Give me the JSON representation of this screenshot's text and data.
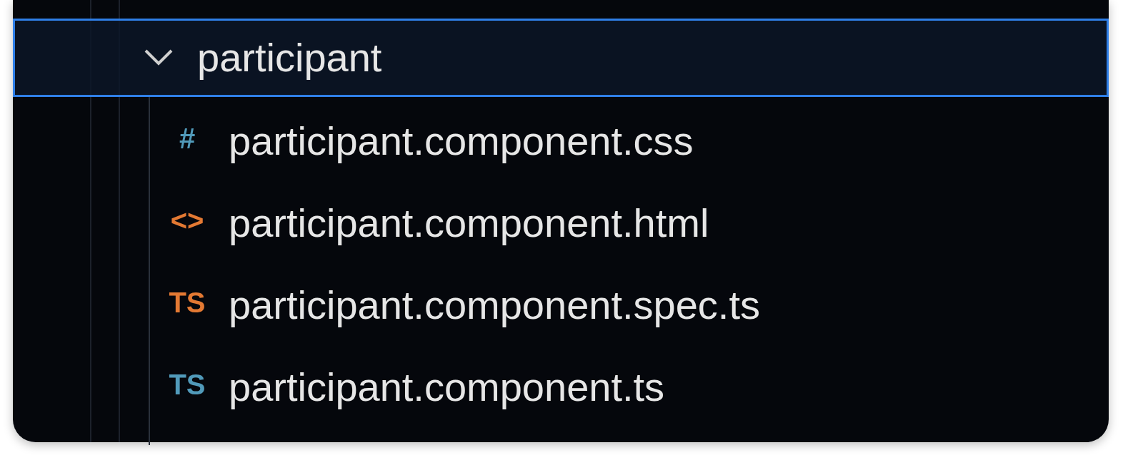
{
  "tree": {
    "label": "participant",
    "expanded": true,
    "selected": true,
    "children": [
      {
        "label": "participant.component.css",
        "icon_text": "#",
        "color": "#519aba"
      },
      {
        "label": "participant.component.html",
        "icon_text": "<>",
        "color": "#e37933"
      },
      {
        "label": "participant.component.spec.ts",
        "icon_text": "TS",
        "color": "#e37933"
      },
      {
        "label": "participant.component.ts",
        "icon_text": "TS",
        "color": "#519aba"
      }
    ]
  }
}
